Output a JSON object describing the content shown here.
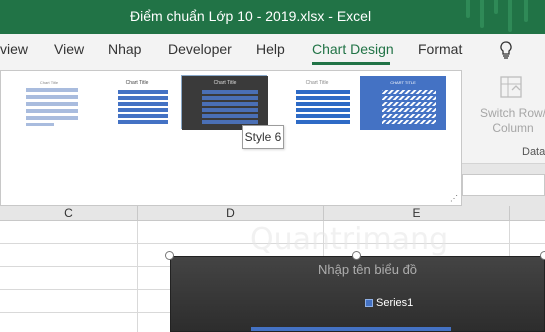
{
  "window": {
    "title": "Điểm chuẩn Lớp 10 - 2019.xlsx  -  Excel"
  },
  "tabs": [
    "view",
    "View",
    "Nhap",
    "Developer",
    "Help",
    "Chart Design",
    "Format"
  ],
  "active_tab": "Chart Design",
  "gallery": {
    "styles": [
      {
        "title": "Chart Title"
      },
      {
        "title": "Chart Title"
      },
      {
        "title": "Chart Title"
      },
      {
        "title": "Chart Title"
      },
      {
        "title": "CHART TITLE"
      }
    ],
    "tooltip": "Style 6"
  },
  "switch_button": {
    "label_line1": "Switch Row/",
    "label_line2": "Column"
  },
  "data_group_label": "Data",
  "columns": [
    "C",
    "D",
    "E"
  ],
  "chart": {
    "legend": "Series1"
  },
  "watermark": {
    "brand": "Quantrimang",
    "tagline": "Nhập tên biểu đồ"
  },
  "colors": {
    "excel_green": "#217346",
    "series": "#4472c4"
  },
  "icons": [
    "lightbulb-icon",
    "switch-row-column-icon",
    "gallery-expand-icon"
  ]
}
